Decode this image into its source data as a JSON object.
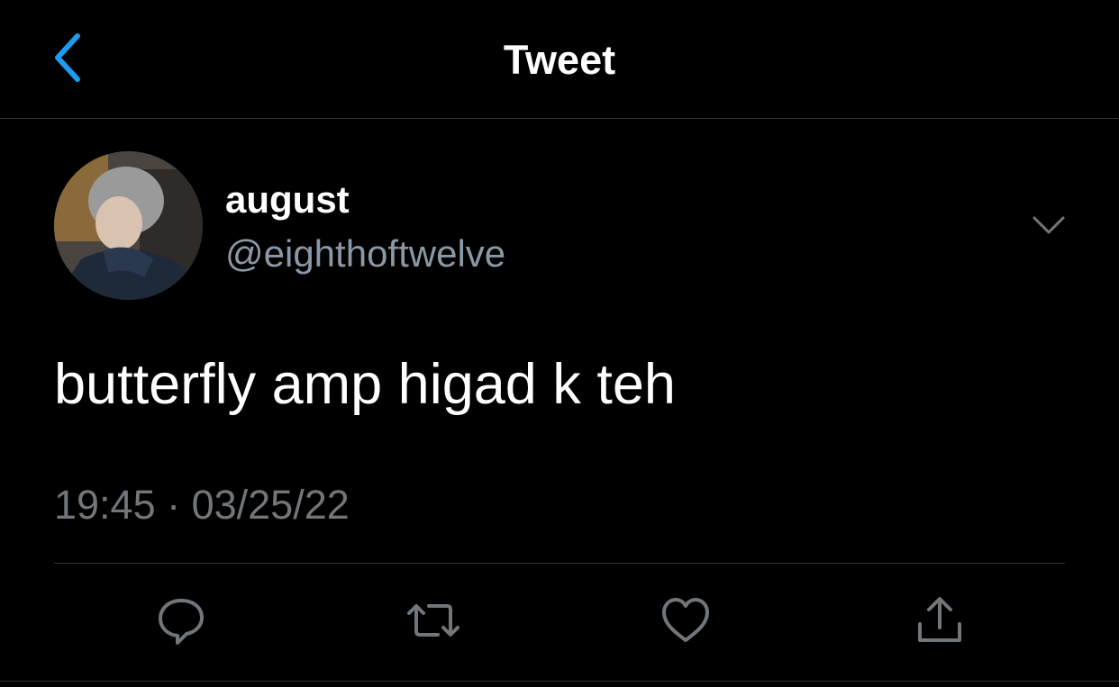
{
  "header": {
    "title": "Tweet",
    "back_icon": "chevron-left-icon"
  },
  "author": {
    "display_name": "august",
    "handle": "@eighthoftwelve",
    "avatar": "profile-photo"
  },
  "tweet": {
    "text": "butterfly amp higad k teh",
    "timestamp": "19:45 · 03/25/22"
  },
  "actions": [
    {
      "name": "reply",
      "icon": "comment-icon"
    },
    {
      "name": "retweet",
      "icon": "retweet-icon"
    },
    {
      "name": "like",
      "icon": "heart-icon"
    },
    {
      "name": "share",
      "icon": "share-icon"
    }
  ],
  "colors": {
    "background": "#000000",
    "accent": "#1d9bf0",
    "secondary_text": "#71767b",
    "divider": "#2f3336"
  }
}
